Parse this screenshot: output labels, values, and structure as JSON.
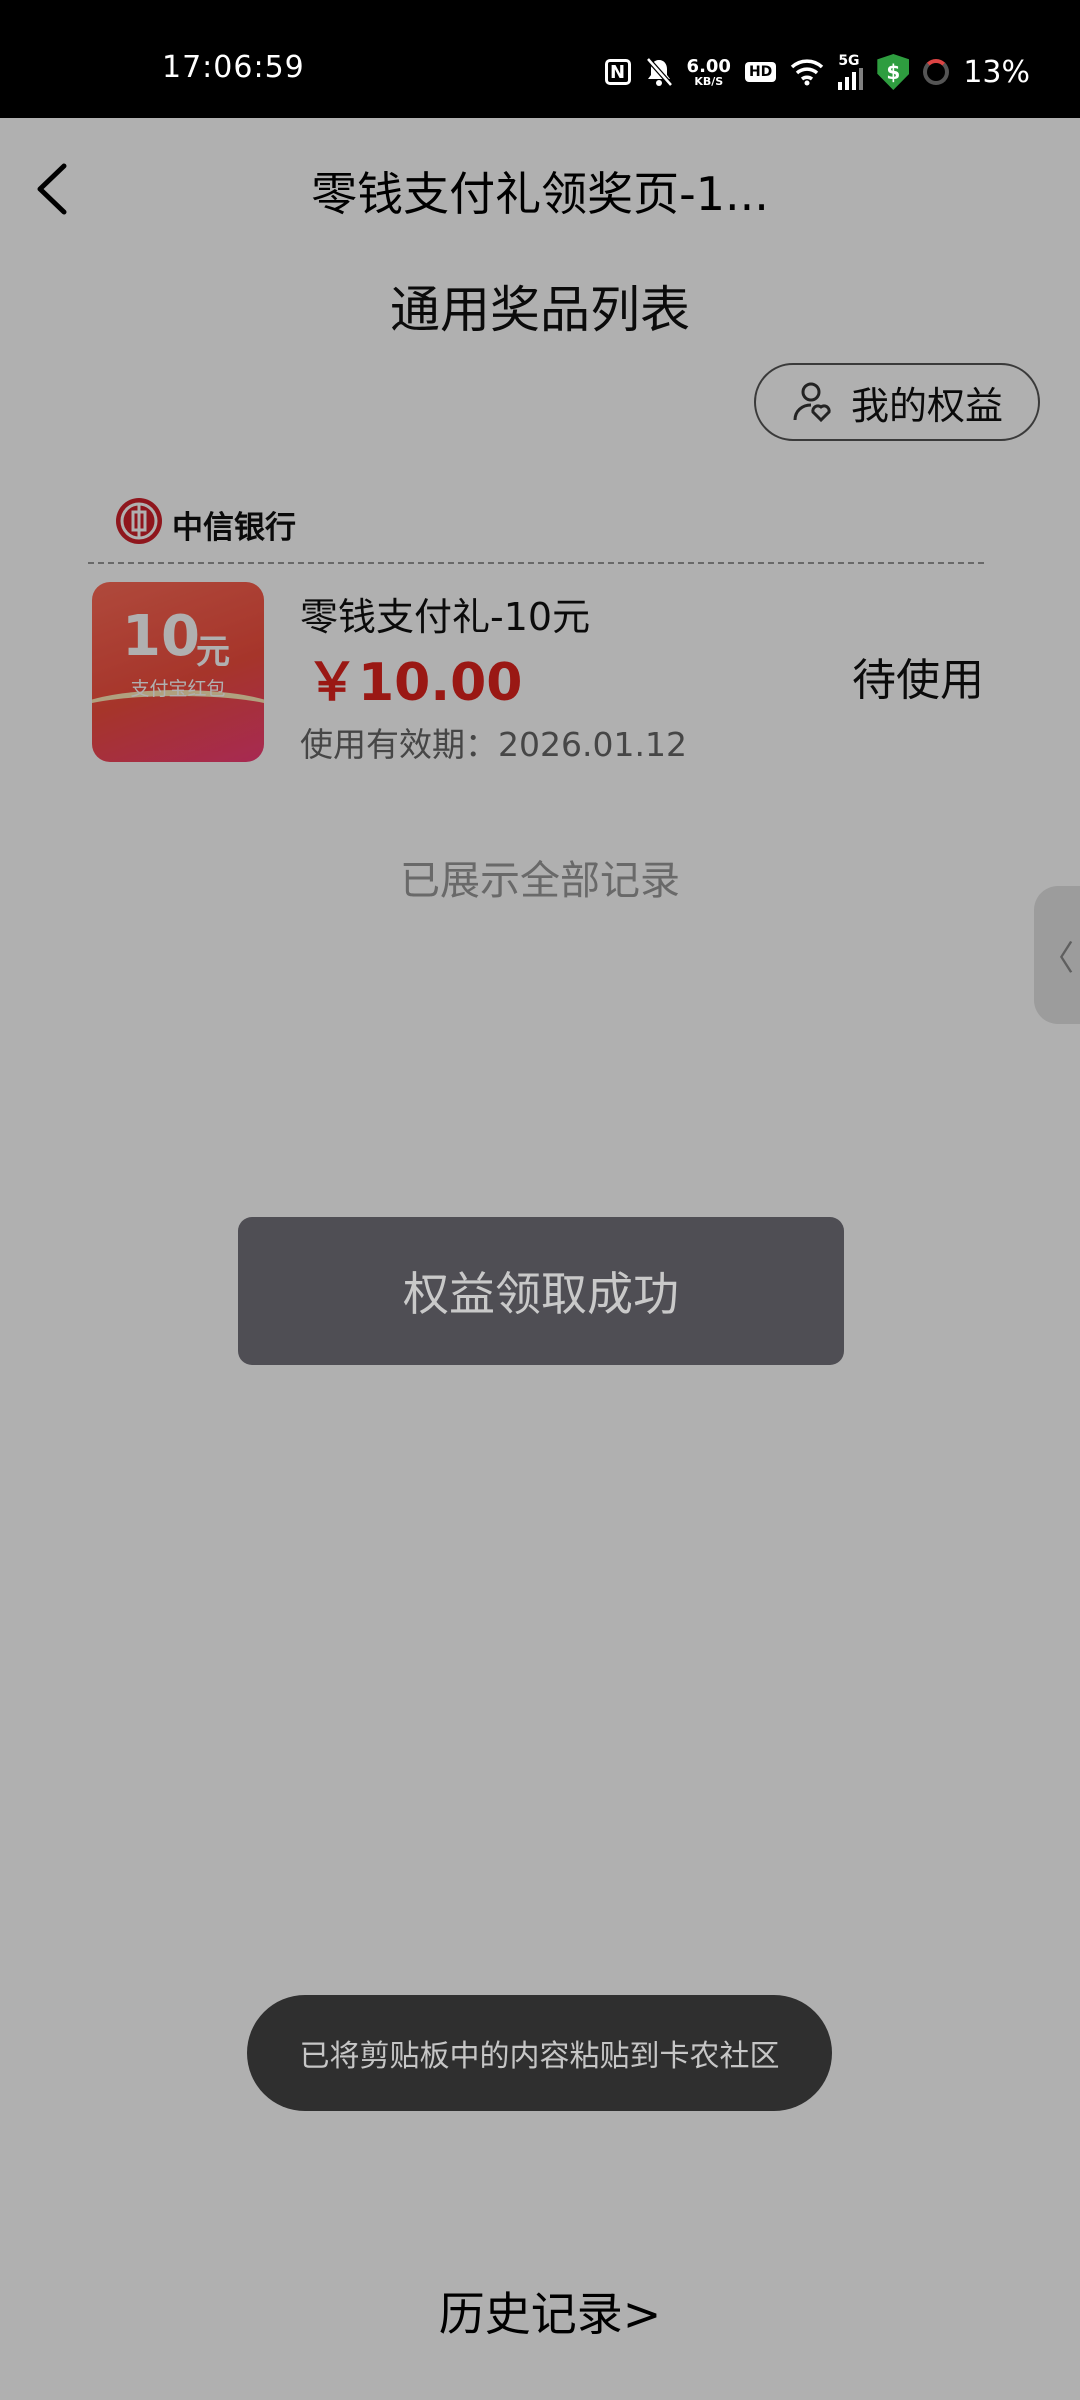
{
  "status_bar": {
    "time": "17:06:59",
    "nfc_icon": "N",
    "net_speed": "6.00",
    "net_speed_unit": "KB/S",
    "hd_badge": "HD",
    "network_type": "5G",
    "shield_symbol": "$",
    "battery_percent": "13%"
  },
  "nav": {
    "title": "零钱支付礼领奖页-1..."
  },
  "page": {
    "section_title": "通用奖品列表",
    "my_rights_label": "我的权益"
  },
  "prize_card": {
    "bank_name": "中信银行",
    "coupon_amount": "10",
    "coupon_unit": "元",
    "coupon_subtitle": "支付宝红包",
    "name": "零钱支付礼-10元",
    "price": "￥10.00",
    "expiry": "使用有效期：2026.01.12",
    "status": "待使用"
  },
  "list_footer": "已展示全部记录",
  "side_handle_glyph": "〈",
  "toasts": {
    "success": "权益领取成功",
    "clipboard": "已将剪贴板中的内容粘贴到卡农社区"
  },
  "history_link": "历史记录>",
  "colors": {
    "price_red": "#e0241e",
    "overlay": "rgba(0,0,0,0.31)",
    "toast_bg": "#4f4e54"
  }
}
